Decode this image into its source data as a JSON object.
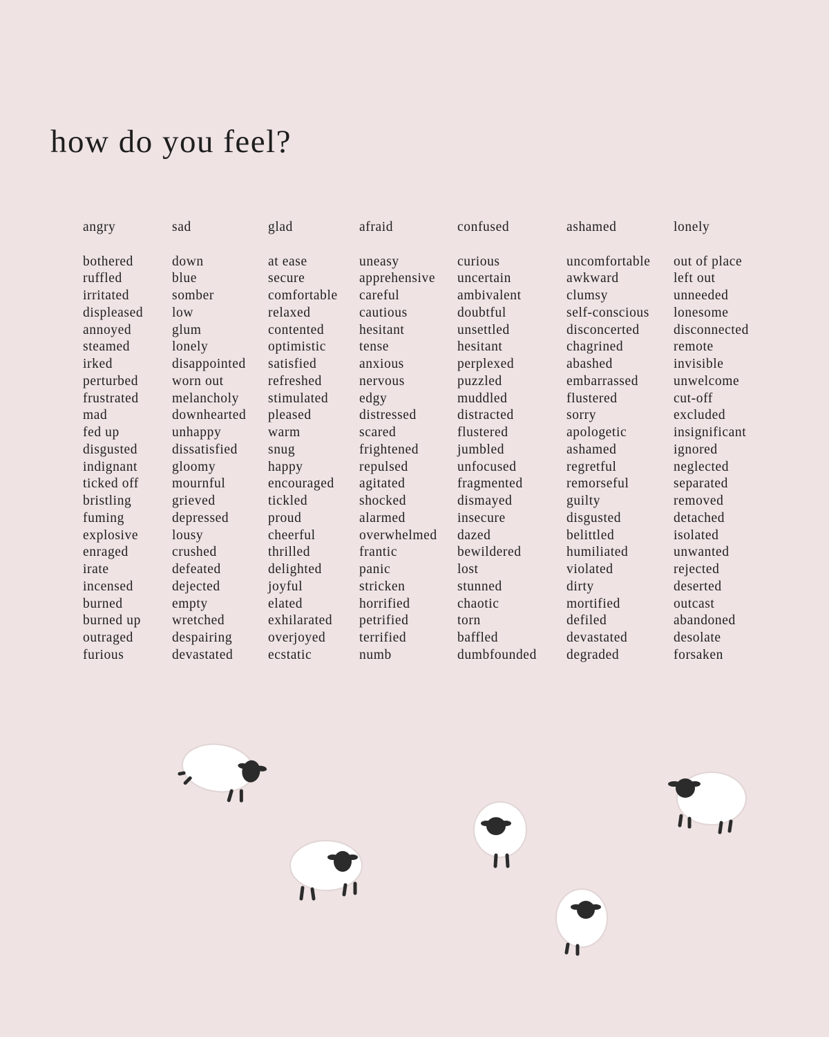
{
  "title": "how do you feel?",
  "columns": [
    {
      "header": "angry",
      "words": [
        "bothered",
        "ruffled",
        "irritated",
        "displeased",
        "annoyed",
        "steamed",
        "irked",
        "perturbed",
        "frustrated",
        "mad",
        "fed up",
        "disgusted",
        "indignant",
        "ticked off",
        "bristling",
        "fuming",
        "explosive",
        "enraged",
        "irate",
        "incensed",
        "burned",
        "burned up",
        "outraged",
        "furious"
      ]
    },
    {
      "header": "sad",
      "words": [
        "down",
        "blue",
        "somber",
        "low",
        "glum",
        "lonely",
        "disappointed",
        "worn out",
        "melancholy",
        "downhearted",
        "unhappy",
        "dissatisfied",
        "gloomy",
        "mournful",
        "grieved",
        "depressed",
        "lousy",
        "crushed",
        "defeated",
        "dejected",
        "empty",
        "wretched",
        "despairing",
        "devastated"
      ]
    },
    {
      "header": "glad",
      "words": [
        "at ease",
        "secure",
        "comfortable",
        "relaxed",
        "contented",
        "optimistic",
        "satisfied",
        "refreshed",
        "stimulated",
        "pleased",
        "warm",
        "snug",
        "happy",
        "encouraged",
        "tickled",
        "proud",
        "cheerful",
        "thrilled",
        "delighted",
        "joyful",
        "elated",
        "exhilarated",
        "overjoyed",
        "ecstatic"
      ]
    },
    {
      "header": "afraid",
      "words": [
        "uneasy",
        "apprehensive",
        "careful",
        "cautious",
        "hesitant",
        "tense",
        "anxious",
        "nervous",
        "edgy",
        "distressed",
        "scared",
        "frightened",
        "repulsed",
        "agitated",
        "shocked",
        "alarmed",
        "overwhelmed",
        "frantic",
        "panic",
        "stricken",
        "horrified",
        "petrified",
        "terrified",
        "numb"
      ]
    },
    {
      "header": "confused",
      "words": [
        "curious",
        "uncertain",
        "ambivalent",
        "doubtful",
        "unsettled",
        "hesitant",
        "perplexed",
        "puzzled",
        "muddled",
        "distracted",
        "flustered",
        "jumbled",
        "unfocused",
        "fragmented",
        "dismayed",
        "insecure",
        "dazed",
        "bewildered",
        "lost",
        "stunned",
        "chaotic",
        "torn",
        "baffled",
        "dumbfounded"
      ]
    },
    {
      "header": "ashamed",
      "words": [
        "uncomfortable",
        "awkward",
        "clumsy",
        "self-conscious",
        "disconcerted",
        "chagrined",
        "abashed",
        "embarrassed",
        "flustered",
        "sorry",
        "apologetic",
        "ashamed",
        "regretful",
        "remorseful",
        "guilty",
        "disgusted",
        "belittled",
        "humiliated",
        "violated",
        "dirty",
        "mortified",
        "defiled",
        "devastated",
        "degraded"
      ]
    },
    {
      "header": "lonely",
      "words": [
        "out of place",
        "left out",
        "unneeded",
        "lonesome",
        "disconnected",
        "remote",
        "invisible",
        "unwelcome",
        "cut-off",
        "excluded",
        "insignificant",
        "ignored",
        "neglected",
        "separated",
        "removed",
        "detached",
        "isolated",
        "unwanted",
        "rejected",
        "deserted",
        "outcast",
        "abandoned",
        "desolate",
        "forsaken"
      ]
    }
  ],
  "colors": {
    "background": "#efe3e4",
    "text": "#1e1e1e",
    "sheep_wool": "#ffffff",
    "sheep_face": "#2b2b2b"
  },
  "decoration": {
    "sheep_icon": "sheep-icon",
    "sheep_count": 5
  }
}
